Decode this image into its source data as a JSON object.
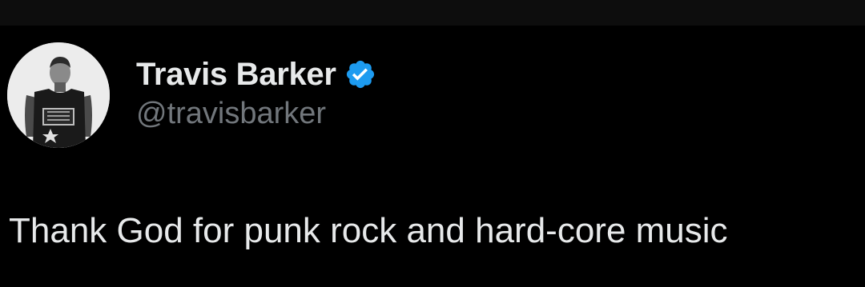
{
  "tweet": {
    "author": {
      "display_name": "Travis Barker",
      "handle": "@travisbarker",
      "verified": true,
      "avatar_icon": "profile-photo",
      "verified_icon": "verified-badge-icon"
    },
    "text": "Thank God for punk rock and hard-core music"
  },
  "colors": {
    "background": "#000000",
    "top_strip": "#0d0d0d",
    "primary_text": "#e7e9ea",
    "secondary_text": "#71767b",
    "verified_blue": "#1d9bf0"
  }
}
